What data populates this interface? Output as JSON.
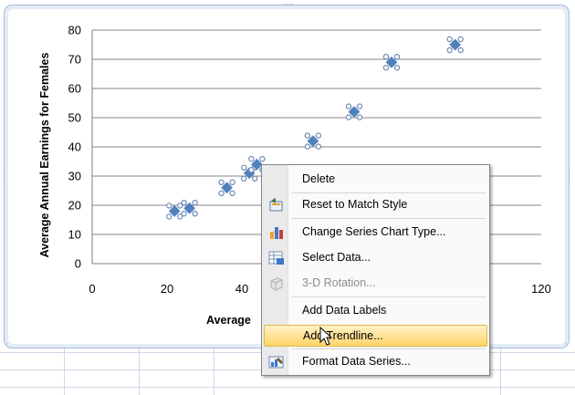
{
  "chart_data": {
    "type": "scatter",
    "xlabel": "Average",
    "ylabel": "Average Annual Earnings for Females",
    "xlim": [
      0,
      120
    ],
    "ylim": [
      0,
      80
    ],
    "x_ticks": [
      "0",
      "20",
      "40",
      "120"
    ],
    "y_ticks": [
      "0",
      "10",
      "20",
      "30",
      "40",
      "50",
      "60",
      "70",
      "80"
    ],
    "grid": true,
    "series": [
      {
        "x": [
          22,
          26,
          36,
          42,
          44,
          59,
          70,
          80,
          97
        ],
        "y": [
          18,
          19,
          26,
          31,
          34,
          42,
          52,
          69,
          75
        ]
      }
    ],
    "colors": {
      "marker": "#4f81bd",
      "selection": "#6d89b3"
    }
  },
  "context_menu": {
    "items": [
      {
        "id": "delete",
        "label": "Delete",
        "icon": "none",
        "disabled": false
      },
      {
        "id": "reset",
        "label": "Reset to Match Style",
        "icon": "reset-style-icon",
        "disabled": false
      },
      {
        "id": "change-type",
        "label": "Change Series Chart Type...",
        "icon": "chart-type-icon",
        "disabled": false
      },
      {
        "id": "select-data",
        "label": "Select Data...",
        "icon": "select-data-icon",
        "disabled": false
      },
      {
        "id": "rotation",
        "label": "3-D Rotation...",
        "icon": "rotation-icon",
        "disabled": true
      },
      {
        "id": "data-labels",
        "label": "Add Data Labels",
        "icon": "none",
        "disabled": false
      },
      {
        "id": "trendline",
        "label": "Add Trendline...",
        "icon": "none",
        "disabled": false,
        "hover": true
      },
      {
        "id": "format-series",
        "label": "Format Data Series...",
        "icon": "format-series-icon",
        "disabled": false
      }
    ]
  }
}
